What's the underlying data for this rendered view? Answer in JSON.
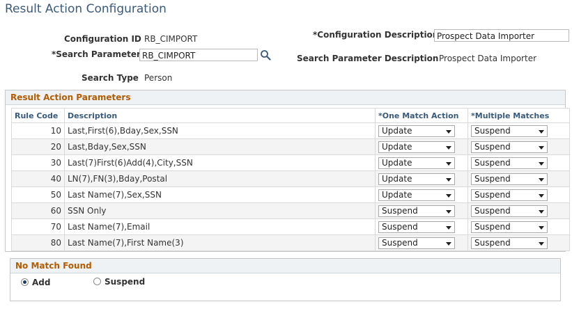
{
  "page": {
    "title": "Result Action Configuration"
  },
  "form": {
    "config_id_label": "Configuration ID",
    "config_id_value": "RB_CIMPORT",
    "config_desc_label": "*Configuration Description",
    "config_desc_value": "Prospect Data Importer",
    "search_param_label": "*Search Parameter",
    "search_param_value": "RB_CIMPORT",
    "search_param_desc_label": "Search Parameter Description",
    "search_param_desc_value": "Prospect Data Importer",
    "search_type_label": "Search Type",
    "search_type_value": "Person",
    "lookup_icon": "magnifier-icon"
  },
  "result_section": {
    "title": "Result Action Parameters",
    "columns": [
      "Rule Code",
      "Description",
      "*One Match Action",
      "*Multiple Matches"
    ],
    "rows": [
      {
        "code": "10",
        "desc": "Last,First(6),Bday,Sex,SSN",
        "one": "Update",
        "multi": "Suspend"
      },
      {
        "code": "20",
        "desc": "Last,Bday,Sex,SSN",
        "one": "Update",
        "multi": "Suspend"
      },
      {
        "code": "30",
        "desc": "Last(7)First(6)Add(4),City,SSN",
        "one": "Update",
        "multi": "Suspend"
      },
      {
        "code": "40",
        "desc": "LN(7),FN(3),Bday,Postal",
        "one": "Update",
        "multi": "Suspend"
      },
      {
        "code": "50",
        "desc": "Last Name(7),Sex,SSN",
        "one": "Update",
        "multi": "Suspend"
      },
      {
        "code": "60",
        "desc": "SSN Only",
        "one": "Suspend",
        "multi": "Suspend"
      },
      {
        "code": "70",
        "desc": "Last Name(7),Email",
        "one": "Suspend",
        "multi": "Suspend"
      },
      {
        "code": "80",
        "desc": "Last Name(7),First Name(3)",
        "one": "Suspend",
        "multi": "Suspend"
      }
    ]
  },
  "no_match_section": {
    "title": "No Match Found",
    "options": [
      {
        "label": "Add",
        "selected": true
      },
      {
        "label": "Suspend",
        "selected": false
      }
    ]
  }
}
